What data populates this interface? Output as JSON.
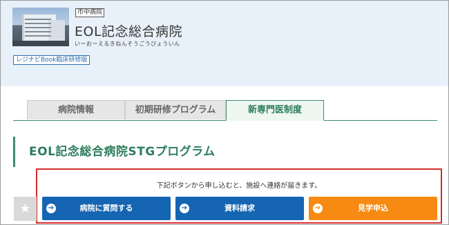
{
  "header": {
    "city_tag": "市中病院",
    "title": "EOL記念総合病院",
    "reading": "いーおーえるきねんそうごうびょういん",
    "book_tag": "レジナビBook臨床研修版"
  },
  "tabs": [
    {
      "label": "病院情報",
      "active": false
    },
    {
      "label": "初期研修プログラム",
      "active": false
    },
    {
      "label": "新専門医制度",
      "active": true
    }
  ],
  "section": {
    "title": "EOL記念総合病院STGプログラム"
  },
  "notice": {
    "text": "下記ボタンから申し込むと、施設へ連絡が届きます。"
  },
  "actions": {
    "star": "★",
    "arrow": "➔",
    "buttons": [
      {
        "label": "病院に質問する",
        "color": "#1565b3"
      },
      {
        "label": "資料請求",
        "color": "#1565b3"
      },
      {
        "label": "見学申込",
        "color": "#f68a12"
      }
    ]
  },
  "colors": {
    "header_bg": "#e8f1f9",
    "accent_green": "#2e7d5e",
    "highlight_red": "#d62b2b"
  }
}
